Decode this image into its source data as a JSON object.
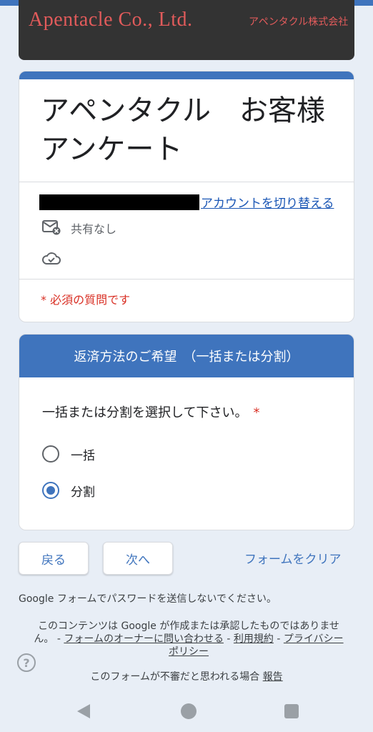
{
  "banner": {
    "company_en": "Apentacle Co., Ltd.",
    "company_jp": "アペンタクル株式会社"
  },
  "form": {
    "title": "アペンタクル　お客様アンケート",
    "switch_account": "アカウントを切り替える",
    "share_status": "共有なし",
    "required_note": "* 必須の質問です"
  },
  "section": {
    "header": "返済方法のご希望　（一括または分割）",
    "question": "一括または分割を選択して下さい。",
    "required_mark": "*",
    "options": [
      {
        "label": "一括",
        "selected": false
      },
      {
        "label": "分割",
        "selected": true
      }
    ]
  },
  "actions": {
    "back": "戻る",
    "next": "次へ",
    "clear": "フォームをクリア"
  },
  "footer": {
    "password_note": "Google フォームでパスワードを送信しないでください。",
    "disclaimer_text": "このコンテンツは Google が作成または承認したものではありません。 - ",
    "contact_owner": "フォームのオーナーに問い合わせる",
    "sep1": " - ",
    "terms": "利用規約",
    "sep2": " - ",
    "privacy": "プライバシー ポリシー",
    "report_prefix": "このフォームが不審だと思われる場合 ",
    "report_link": "報告",
    "help_symbol": "?"
  },
  "colors": {
    "accent": "#3f74bd",
    "required": "#d93025",
    "banner_bg": "#333333",
    "banner_text": "#e25b5b",
    "page_bg": "#e8eef6"
  },
  "icons": [
    "mail-unshared-icon",
    "cloud-check-icon",
    "help-icon",
    "nav-back-icon",
    "nav-home-icon",
    "nav-recent-icon"
  ]
}
